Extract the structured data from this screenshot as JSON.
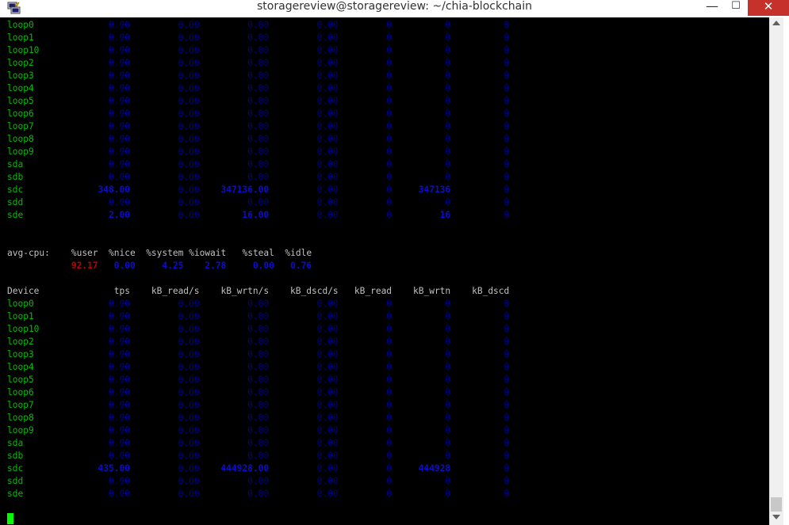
{
  "window": {
    "title": "storagereview@storagereview: ~/chia-blockchain",
    "minimize_glyph": "—",
    "maximize_glyph": "☐",
    "close_glyph": "✕",
    "icon": "putty-icon"
  },
  "colors": {
    "device": "#00c000",
    "value": "#00009c",
    "value_highlight": "#0c0cd4",
    "user_cpu": "#c00000",
    "cursor": "#00ff00"
  },
  "block1": {
    "rows": [
      [
        "loop0",
        "0.00",
        "0.00",
        "0.00",
        "0.00",
        "0",
        "0",
        "0"
      ],
      [
        "loop1",
        "0.00",
        "0.00",
        "0.00",
        "0.00",
        "0",
        "0",
        "0"
      ],
      [
        "loop10",
        "0.00",
        "0.00",
        "0.00",
        "0.00",
        "0",
        "0",
        "0"
      ],
      [
        "loop2",
        "0.00",
        "0.00",
        "0.00",
        "0.00",
        "0",
        "0",
        "0"
      ],
      [
        "loop3",
        "0.00",
        "0.00",
        "0.00",
        "0.00",
        "0",
        "0",
        "0"
      ],
      [
        "loop4",
        "0.00",
        "0.00",
        "0.00",
        "0.00",
        "0",
        "0",
        "0"
      ],
      [
        "loop5",
        "0.00",
        "0.00",
        "0.00",
        "0.00",
        "0",
        "0",
        "0"
      ],
      [
        "loop6",
        "0.00",
        "0.00",
        "0.00",
        "0.00",
        "0",
        "0",
        "0"
      ],
      [
        "loop7",
        "0.00",
        "0.00",
        "0.00",
        "0.00",
        "0",
        "0",
        "0"
      ],
      [
        "loop8",
        "0.00",
        "0.00",
        "0.00",
        "0.00",
        "0",
        "0",
        "0"
      ],
      [
        "loop9",
        "0.00",
        "0.00",
        "0.00",
        "0.00",
        "0",
        "0",
        "0"
      ],
      [
        "sda",
        "0.00",
        "0.00",
        "0.00",
        "0.00",
        "0",
        "0",
        "0"
      ],
      [
        "sdb",
        "0.00",
        "0.00",
        "0.00",
        "0.00",
        "0",
        "0",
        "0"
      ],
      [
        "sdc",
        "348.00",
        "0.00",
        "347136.00",
        "0.00",
        "0",
        "347136",
        "0"
      ],
      [
        "sdd",
        "0.00",
        "0.00",
        "0.00",
        "0.00",
        "0",
        "0",
        "0"
      ],
      [
        "sde",
        "2.00",
        "0.00",
        "16.00",
        "0.00",
        "0",
        "16",
        "0"
      ]
    ]
  },
  "cpu": {
    "label": "avg-cpu:",
    "headers": [
      "%user",
      "%nice",
      "%system",
      "%iowait",
      "%steal",
      "%idle"
    ],
    "values": [
      "92.17",
      "0.00",
      "4.25",
      "2.78",
      "0.00",
      "0.76"
    ]
  },
  "block2": {
    "headers": [
      "Device",
      "tps",
      "kB_read/s",
      "kB_wrtn/s",
      "kB_dscd/s",
      "kB_read",
      "kB_wrtn",
      "kB_dscd"
    ],
    "rows": [
      [
        "loop0",
        "0.00",
        "0.00",
        "0.00",
        "0.00",
        "0",
        "0",
        "0"
      ],
      [
        "loop1",
        "0.00",
        "0.00",
        "0.00",
        "0.00",
        "0",
        "0",
        "0"
      ],
      [
        "loop10",
        "0.00",
        "0.00",
        "0.00",
        "0.00",
        "0",
        "0",
        "0"
      ],
      [
        "loop2",
        "0.00",
        "0.00",
        "0.00",
        "0.00",
        "0",
        "0",
        "0"
      ],
      [
        "loop3",
        "0.00",
        "0.00",
        "0.00",
        "0.00",
        "0",
        "0",
        "0"
      ],
      [
        "loop4",
        "0.00",
        "0.00",
        "0.00",
        "0.00",
        "0",
        "0",
        "0"
      ],
      [
        "loop5",
        "0.00",
        "0.00",
        "0.00",
        "0.00",
        "0",
        "0",
        "0"
      ],
      [
        "loop6",
        "0.00",
        "0.00",
        "0.00",
        "0.00",
        "0",
        "0",
        "0"
      ],
      [
        "loop7",
        "0.00",
        "0.00",
        "0.00",
        "0.00",
        "0",
        "0",
        "0"
      ],
      [
        "loop8",
        "0.00",
        "0.00",
        "0.00",
        "0.00",
        "0",
        "0",
        "0"
      ],
      [
        "loop9",
        "0.00",
        "0.00",
        "0.00",
        "0.00",
        "0",
        "0",
        "0"
      ],
      [
        "sda",
        "0.00",
        "0.00",
        "0.00",
        "0.00",
        "0",
        "0",
        "0"
      ],
      [
        "sdb",
        "0.00",
        "0.00",
        "0.00",
        "0.00",
        "0",
        "0",
        "0"
      ],
      [
        "sdc",
        "435.00",
        "0.00",
        "444928.00",
        "0.00",
        "0",
        "444928",
        "0"
      ],
      [
        "sdd",
        "0.00",
        "0.00",
        "0.00",
        "0.00",
        "0",
        "0",
        "0"
      ],
      [
        "sde",
        "0.00",
        "0.00",
        "0.00",
        "0.00",
        "0",
        "0",
        "0"
      ]
    ]
  }
}
